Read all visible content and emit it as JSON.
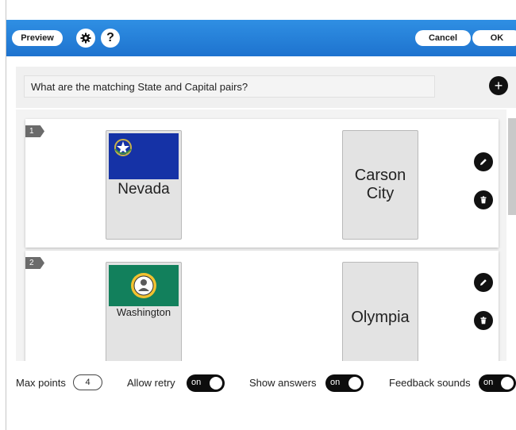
{
  "toolbar": {
    "preview_label": "Preview",
    "cancel_label": "Cancel",
    "ok_label": "OK",
    "help_glyph": "?",
    "gear_icon": "gear-icon",
    "help_icon": "help-icon",
    "accent": "#1e73cf"
  },
  "question": {
    "text": "What are the matching State and Capital pairs?",
    "add_icon": "plus-icon",
    "add_glyph": "+"
  },
  "pairs": [
    {
      "number": "1",
      "state": "Nevada",
      "capital": "Carson City",
      "flag_color": "#1532a6"
    },
    {
      "number": "2",
      "state": "Washington",
      "capital": "Olympia",
      "flag_color": "#12805c"
    }
  ],
  "pair_actions": {
    "edit_icon": "pencil-icon",
    "delete_icon": "trash-icon"
  },
  "settings": {
    "max_points_label": "Max points",
    "max_points_value": "4",
    "allow_retry_label": "Allow retry",
    "allow_retry_state": "on",
    "show_answers_label": "Show answers",
    "show_answers_state": "on",
    "feedback_sounds_label": "Feedback sounds",
    "feedback_sounds_state": "on"
  }
}
